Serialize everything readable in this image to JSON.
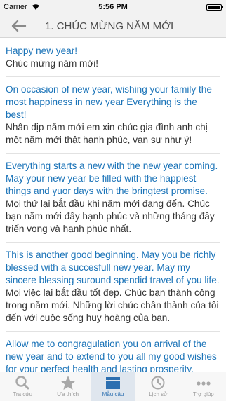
{
  "status": {
    "carrier": "Carrier",
    "time": "5:56 PM"
  },
  "nav": {
    "title": "1. CHÚC MỪNG NĂM MỚI"
  },
  "entries": [
    {
      "en": "Happy new year!",
      "vi": "Chúc mừng năm mới!"
    },
    {
      "en": "On occasion of new year, wishing your family the most happiness in new year Everything is the best!",
      "vi": "Nhân dịp năm mới em xin chúc gia đình anh chị một năm mới thật hạnh phúc, vạn sự như ý!"
    },
    {
      "en": "Everything starts a new with the new year coming. May your new year be filled with the happiest things and yuor days with the bringtest promise.",
      "vi": "Mọi thứ lại bắt đầu khi năm mới đang đến. Chúc bạn năm mới đầy hạnh phúc và những tháng đầy triển vọng và hạnh phúc nhất."
    },
    {
      "en": "This is another good beginning. May you be richly blessed with a succesfull new year. May my sincere blessing suround spendid travel of you life.",
      "vi": "Mọi việc lại bắt đầu tốt đẹp. Chúc bạn thành công trong năm mới. Những lời chúc chân thành của tôi đến với cuộc sống huy hoàng của bạn."
    },
    {
      "en": "Allow me to congragulation you on arrival of the new year and to extend to you all my good wishes for your perfect health and lasting prosperity.",
      "vi": ""
    }
  ],
  "tabs": [
    {
      "label": "Tra cứu",
      "icon": "search-icon"
    },
    {
      "label": "Ưa thích",
      "icon": "star-icon"
    },
    {
      "label": "Mẫu câu",
      "icon": "book-icon"
    },
    {
      "label": "Lịch sử",
      "icon": "clock-icon"
    },
    {
      "label": "Trợ giúp",
      "icon": "more-icon"
    }
  ]
}
